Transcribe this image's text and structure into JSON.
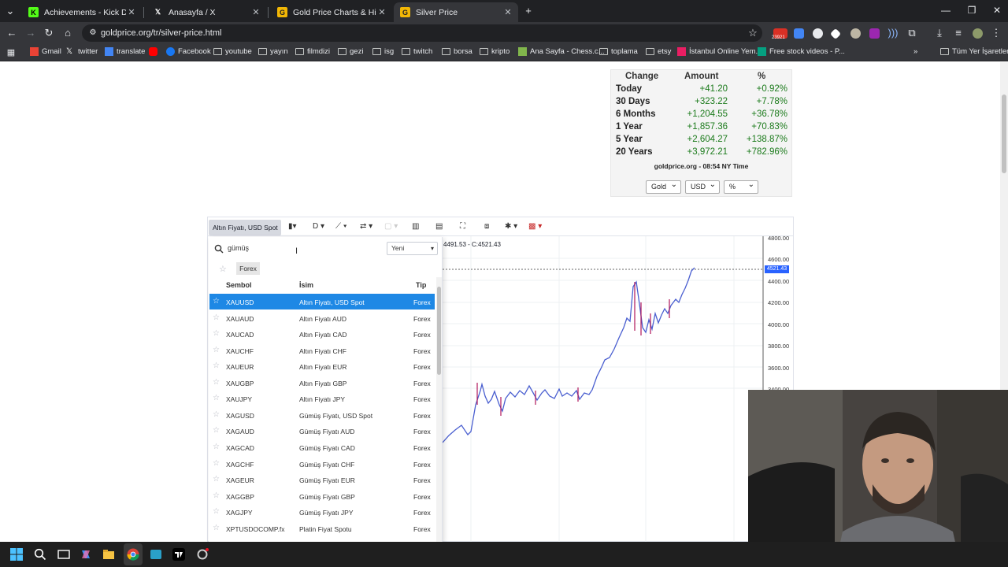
{
  "browser": {
    "tabs": [
      {
        "title": "Achievements - Kick Dashboard",
        "active": false,
        "favicon": "kick-icon"
      },
      {
        "title": "Anasayfa / X",
        "active": false,
        "favicon": "x-icon"
      },
      {
        "title": "Gold Price Charts & Historical D",
        "active": false,
        "favicon": "goldprice-icon"
      },
      {
        "title": "Silver Price",
        "active": true,
        "favicon": "goldprice-icon"
      }
    ],
    "url": "goldprice.org/tr/silver-price.html",
    "extension_badge": "23921",
    "bookmarks": [
      "Gmail",
      "twitter",
      "translate",
      "Facebook",
      "youtube",
      "yayın",
      "filmdizi",
      "gezi",
      "isg",
      "twitch",
      "borsa",
      "kripto",
      "Ana Sayfa - Chess.c...",
      "toplama",
      "etsy",
      "İstanbul Online Yem...",
      "Free stock videos - P...",
      "Tüm Yer İşaretleri"
    ]
  },
  "change_table": {
    "headers": [
      "Change",
      "Amount",
      "%"
    ],
    "rows": [
      {
        "label": "Today",
        "amount": "+41.20",
        "pct": "+0.92%"
      },
      {
        "label": "30 Days",
        "amount": "+323.22",
        "pct": "+7.78%"
      },
      {
        "label": "6 Months",
        "amount": "+1,204.55",
        "pct": "+36.78%"
      },
      {
        "label": "1 Year",
        "amount": "+1,857.36",
        "pct": "+70.83%"
      },
      {
        "label": "5 Year",
        "amount": "+2,604.27",
        "pct": "+138.87%"
      },
      {
        "label": "20 Years",
        "amount": "+3,972.21",
        "pct": "+782.96%"
      }
    ],
    "source": "goldprice.org - 08:54 NY Time",
    "selects": [
      "Gold",
      "USD",
      "%"
    ]
  },
  "chart_widget": {
    "symbol_button": "Altın Fiyatı, USD Spot",
    "interval": "D",
    "ohlc_text": "4491.53 - C:4521.43",
    "last_price": "4521.43",
    "price_ticks": [
      "4800.00",
      "4600.00",
      "4400.00",
      "4200.00",
      "4000.00",
      "3800.00",
      "3600.00",
      "3400.00"
    ]
  },
  "symbol_search": {
    "query": "gümüş",
    "sort_select": "Yeni",
    "filter_chip": "Forex",
    "columns": [
      "Sembol",
      "İsim",
      "Tip"
    ],
    "results": [
      {
        "symbol": "XAUUSD",
        "name": "Altın Fiyatı, USD Spot",
        "type": "Forex",
        "selected": true
      },
      {
        "symbol": "XAUAUD",
        "name": "Altın Fiyatı AUD",
        "type": "Forex"
      },
      {
        "symbol": "XAUCAD",
        "name": "Altın Fiyatı CAD",
        "type": "Forex"
      },
      {
        "symbol": "XAUCHF",
        "name": "Altın Fiyatı CHF",
        "type": "Forex"
      },
      {
        "symbol": "XAUEUR",
        "name": "Altın Fiyatı EUR",
        "type": "Forex"
      },
      {
        "symbol": "XAUGBP",
        "name": "Altın Fiyatı GBP",
        "type": "Forex"
      },
      {
        "symbol": "XAUJPY",
        "name": "Altın Fiyatı JPY",
        "type": "Forex"
      },
      {
        "symbol": "XAGUSD",
        "name": "Gümüş Fiyatı, USD Spot",
        "type": "Forex"
      },
      {
        "symbol": "XAGAUD",
        "name": "Gümüş Fiyatı AUD",
        "type": "Forex"
      },
      {
        "symbol": "XAGCAD",
        "name": "Gümüş Fiyatı CAD",
        "type": "Forex"
      },
      {
        "symbol": "XAGCHF",
        "name": "Gümüş Fiyatı CHF",
        "type": "Forex"
      },
      {
        "symbol": "XAGEUR",
        "name": "Gümüş Fiyatı EUR",
        "type": "Forex"
      },
      {
        "symbol": "XAGGBP",
        "name": "Gümüş Fiyatı GBP",
        "type": "Forex"
      },
      {
        "symbol": "XAGJPY",
        "name": "Gümüş Fiyatı JPY",
        "type": "Forex"
      },
      {
        "symbol": "XPTUSDOCOMP.fx",
        "name": "Platin Fiyat Spotu",
        "type": "Forex"
      }
    ]
  },
  "colors": {
    "positive": "#1a7a1a",
    "selection": "#1e88e5",
    "last_price_tag": "#2962ff",
    "candle_up": "#4a5fd0",
    "candle_down": "#b0165a"
  }
}
